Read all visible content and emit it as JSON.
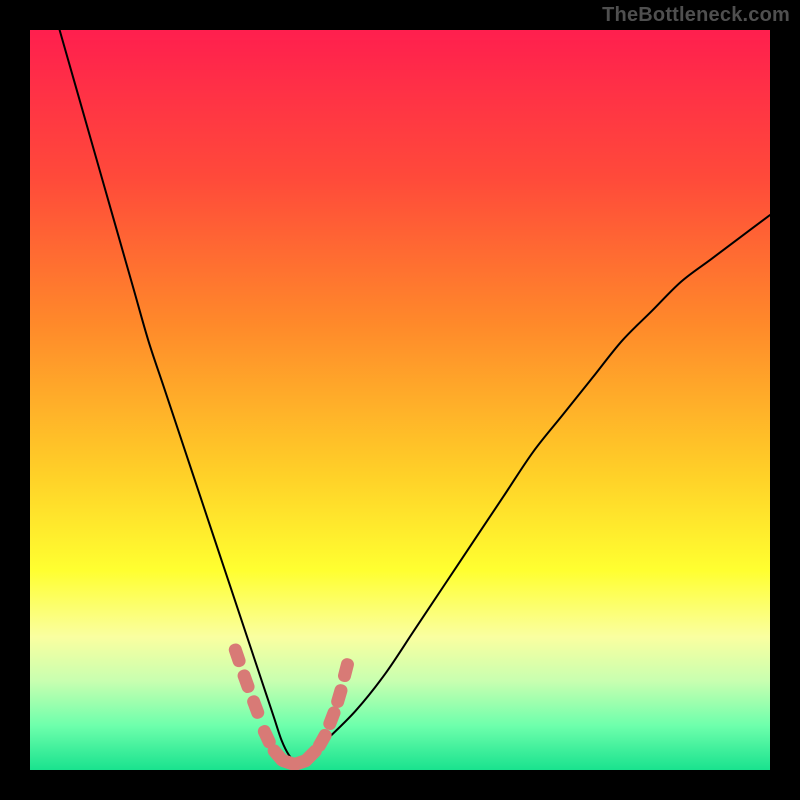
{
  "attribution": "TheBottleneck.com",
  "chart_data": {
    "type": "line",
    "title": "",
    "xlabel": "",
    "ylabel": "",
    "xlim": [
      0,
      100
    ],
    "ylim": [
      0,
      100
    ],
    "gradient_stops": [
      {
        "offset": 0.0,
        "color": "#ff1f4e"
      },
      {
        "offset": 0.2,
        "color": "#ff4a3a"
      },
      {
        "offset": 0.4,
        "color": "#ff8a2a"
      },
      {
        "offset": 0.6,
        "color": "#ffd028"
      },
      {
        "offset": 0.73,
        "color": "#ffff30"
      },
      {
        "offset": 0.82,
        "color": "#faffa0"
      },
      {
        "offset": 0.88,
        "color": "#c8ffb0"
      },
      {
        "offset": 0.94,
        "color": "#6effac"
      },
      {
        "offset": 1.0,
        "color": "#19e28e"
      }
    ],
    "series": [
      {
        "name": "bottleneck-curve",
        "stroke": "#000000",
        "stroke_width": 2.0,
        "x": [
          4,
          6,
          8,
          10,
          12,
          14,
          16,
          18,
          20,
          22,
          24,
          26,
          28,
          30,
          31,
          32,
          33,
          34,
          35,
          36,
          37,
          38,
          40,
          44,
          48,
          52,
          56,
          60,
          64,
          68,
          72,
          76,
          80,
          84,
          88,
          92,
          96,
          100
        ],
        "y": [
          100,
          93,
          86,
          79,
          72,
          65,
          58,
          52,
          46,
          40,
          34,
          28,
          22,
          16,
          13,
          10,
          7,
          4,
          2,
          1,
          1,
          2,
          4,
          8,
          13,
          19,
          25,
          31,
          37,
          43,
          48,
          53,
          58,
          62,
          66,
          69,
          72,
          75
        ]
      },
      {
        "name": "marker-dots",
        "type": "scatter",
        "marker_shape": "rounded-rect",
        "marker_color": "#d87a76",
        "x": [
          28.0,
          29.2,
          30.5,
          32.0,
          33.5,
          35.0,
          36.5,
          38.0,
          39.5,
          40.8,
          41.8,
          42.7
        ],
        "y": [
          15.5,
          12.0,
          8.5,
          4.5,
          2.0,
          1.0,
          1.0,
          2.0,
          4.0,
          7.0,
          10.0,
          13.5
        ]
      }
    ]
  }
}
